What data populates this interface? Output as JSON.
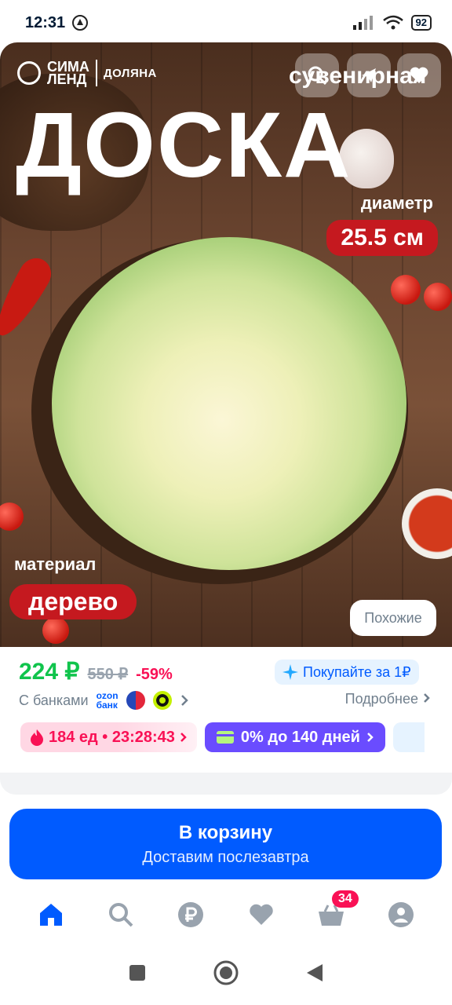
{
  "status_bar": {
    "time": "12:31",
    "battery": "92"
  },
  "hero": {
    "brand_name_line1": "СИМА",
    "brand_name_line2": "ЛЕНД",
    "brand_partner": "ДОЛЯНА",
    "title": "ДОСКА",
    "subtitle": "сувенирная",
    "diameter_label": "диаметр",
    "diameter_value": "25.5 см",
    "material_label": "материал",
    "material_value": "дерево",
    "similar_button": "Похожие"
  },
  "price": {
    "current": "224 ₽",
    "old": "550 ₽",
    "discount": "-59%",
    "buy_for_label": "Покупайте за 1₽",
    "banks_label": "С банками",
    "ozon_bank_line1": "ozon",
    "ozon_bank_line2": "банк",
    "details_label": "Подробнее"
  },
  "chips": {
    "stock_text": "184 ед • 23:28:43",
    "credit_text": "0% до 140 дней"
  },
  "cart": {
    "button_label": "В корзину",
    "delivery_label": "Доставим послезавтра"
  },
  "tabbar": {
    "cart_badge": "34",
    "items": [
      "home-icon",
      "search-icon",
      "ruble-icon",
      "heart-icon",
      "basket-icon",
      "profile-icon"
    ]
  },
  "colors": {
    "accent_blue": "#005bff",
    "price_green": "#10c44c",
    "discount_pink": "#f91155",
    "label_red": "#c5191f",
    "credit_purple": "#6a4cff"
  }
}
